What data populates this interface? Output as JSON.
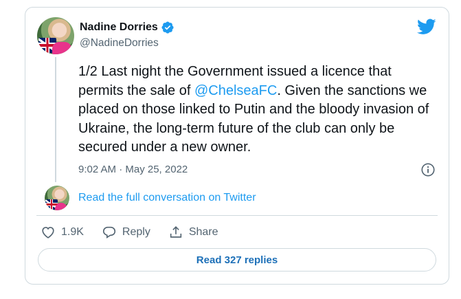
{
  "author": {
    "name": "Nadine Dorries",
    "handle": "@NadineDorries",
    "verified": true
  },
  "tweet": {
    "text_part1": "1/2 Last night the Government issued a licence that permits the sale of ",
    "mention": "@ChelseaFC",
    "text_part2": ". Given the sanctions we placed on those linked to Putin and the bloody invasion of Ukraine, the long-term future of the club can only be secured under a new owner.",
    "timestamp": "9:02 AM · May 25, 2022"
  },
  "conversation_link": "Read the full conversation on Twitter",
  "actions": {
    "like_count": "1.9K",
    "reply_label": "Reply",
    "share_label": "Share"
  },
  "replies_button": "Read 327 replies",
  "icons": {
    "brand": "twitter-bird-icon",
    "verified": "verified-badge-icon",
    "info": "info-icon",
    "like": "heart-icon",
    "reply": "speech-bubble-icon",
    "share": "share-upload-icon"
  },
  "colors": {
    "accent": "#1d9bf0",
    "text": "#0f1419",
    "muted": "#536471",
    "border": "#cfd9de"
  }
}
